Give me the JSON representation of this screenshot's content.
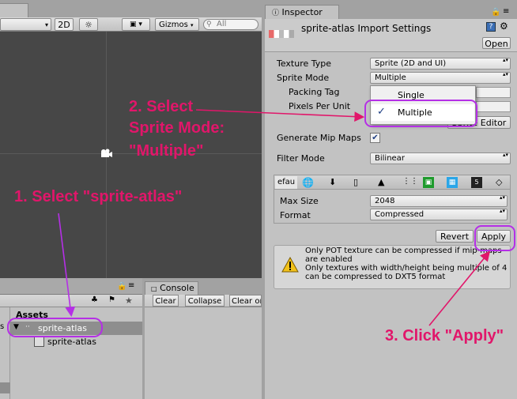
{
  "scene": {
    "tab_title": "",
    "mode_2d": "2D",
    "gizmos_label": "Gizmos",
    "search_placeholder": "All"
  },
  "project": {
    "assets_label": "Assets",
    "tree_item": "sprite-atlas",
    "child_item": "sprite-atlas"
  },
  "console": {
    "tab": "Console",
    "clear": "Clear",
    "collapse": "Collapse",
    "clear_on_play": "Clear or"
  },
  "inspector": {
    "tab": "Inspector",
    "title": "sprite-atlas Import Settings",
    "open_button": "Open",
    "texture_type_label": "Texture Type",
    "texture_type_value": "Sprite (2D and UI)",
    "sprite_mode_label": "Sprite Mode",
    "sprite_mode_value": "Multiple",
    "packing_tag_label": "Packing Tag",
    "pixels_per_unit_label": "Pixels Per Unit",
    "sprite_editor_button": "Sprite Editor",
    "generate_mip_maps_label": "Generate Mip Maps",
    "generate_mip_maps_checked": true,
    "filter_mode_label": "Filter Mode",
    "filter_mode_value": "Bilinear",
    "platform_default_tab": "efau",
    "max_size_label": "Max Size",
    "max_size_value": "2048",
    "format_label": "Format",
    "format_value": "Compressed",
    "revert_button": "Revert",
    "apply_button": "Apply",
    "warning_line1": "Only POT texture can be compressed if mip-maps",
    "warning_line2": "are enabled",
    "warning_line3": "Only textures with width/height being multiple of 4",
    "warning_line4": "can be compressed to DXT5 format"
  },
  "sprite_mode_dropdown": {
    "options": [
      "Single",
      "Multiple"
    ],
    "selected": "Multiple"
  },
  "annotations": {
    "step1": "1. Select \"sprite-atlas\"",
    "step2_line1": "2. Select",
    "step2_line2": "Sprite Mode:",
    "step2_line3": "\"Multiple\"",
    "step3": "3. Click \"Apply\""
  },
  "colors": {
    "annotation": "#e1166a",
    "highlight": "#b52fe6",
    "selected_row": "#8e8e8e",
    "scene_bg": "#474747"
  }
}
